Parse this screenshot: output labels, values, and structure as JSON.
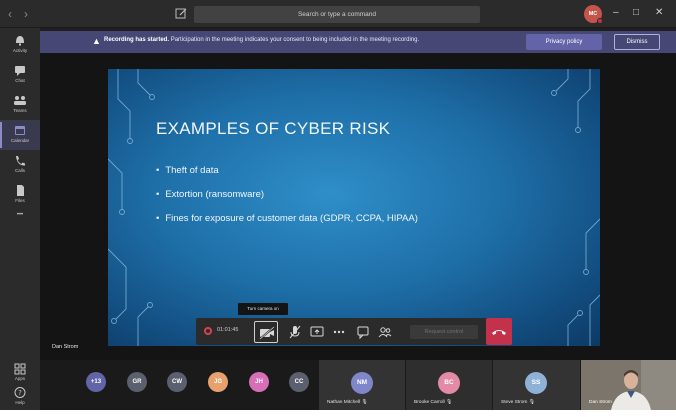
{
  "titlebar": {
    "back_glyph": "‹",
    "forward_glyph": "›",
    "compose_icon": "compose-icon",
    "search_placeholder": "Search or type a command",
    "avatar_initials": "MC",
    "minimize_glyph": "–",
    "maximize_glyph": "□",
    "close_glyph": "✕"
  },
  "rail": {
    "items": [
      {
        "label": "Activity",
        "icon": "bell-icon"
      },
      {
        "label": "Chat",
        "icon": "chat-icon"
      },
      {
        "label": "Teams",
        "icon": "teams-icon"
      },
      {
        "label": "Calendar",
        "icon": "calendar-icon",
        "active": true
      },
      {
        "label": "Calls",
        "icon": "phone-icon"
      },
      {
        "label": "Files",
        "icon": "file-icon"
      }
    ],
    "more_glyph": "•••",
    "apps_label": "Apps",
    "help_label": "Help"
  },
  "banner": {
    "bold": "Recording has started.",
    "text": "Participation in the meeting indicates your consent to being included in the meeting recording.",
    "privacy_label": "Privacy policy",
    "dismiss_label": "Dismiss"
  },
  "slide": {
    "title": "EXAMPLES OF CYBER RISK",
    "bullets": [
      "Theft of data",
      "Extortion (ransomware)",
      "Fines for exposure of customer data (GDPR, CCPA, HIPAA)"
    ]
  },
  "stage": {
    "presenter": "Dan Strom",
    "tooltip": "Turn camera on"
  },
  "controls": {
    "timer": "01:01:45",
    "request_label": "Request control"
  },
  "participants": {
    "overflow": "+13",
    "pills": [
      {
        "initials": "GR",
        "color": "#5b5f6e"
      },
      {
        "initials": "CW",
        "color": "#5b5f6e"
      },
      {
        "initials": "JG",
        "color": "#e8a06f"
      },
      {
        "initials": "JH",
        "color": "#d66fb7"
      },
      {
        "initials": "CC",
        "color": "#5b5f6e"
      }
    ],
    "overflow_color": "#6264a7",
    "tiles": [
      {
        "initials": "NM",
        "name": "Nathan Mitchell",
        "color": "#7f86c9"
      },
      {
        "initials": "BC",
        "name": "Brooke Carroll",
        "color": "#e28aa6"
      },
      {
        "initials": "SS",
        "name": "Steve Strom",
        "color": "#8fb1d6"
      }
    ],
    "video_name": "Dan Strom"
  },
  "colors": {
    "accent": "#6264a7",
    "banner": "#464775",
    "hangup": "#c4314b"
  }
}
